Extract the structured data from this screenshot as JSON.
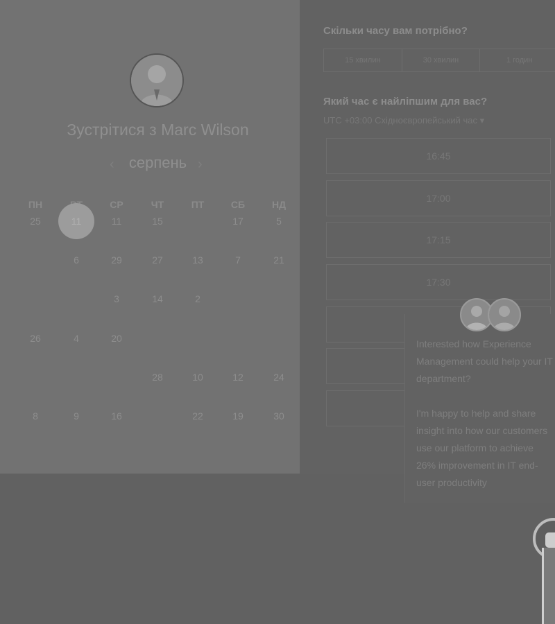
{
  "host": {
    "title": "Зустрітися з Marc Wilson",
    "avatar_icon": "person-avatar"
  },
  "calendar": {
    "month": "серпень",
    "prev_icon": "chevron-left-icon",
    "next_icon": "chevron-right-icon",
    "weekdays": [
      "ПН",
      "ВТ",
      "СР",
      "ЧТ",
      "ПТ",
      "СБ",
      "НД"
    ],
    "weeks": [
      [
        "25",
        "11",
        "11",
        "15",
        "",
        "17",
        "5"
      ],
      [
        "",
        "6",
        "29",
        "27",
        "13",
        "7",
        "21"
      ],
      [
        "",
        "",
        "3",
        "14",
        "2",
        "",
        ""
      ],
      [
        "26",
        "4",
        "20",
        "",
        "",
        "",
        ""
      ],
      [
        "",
        "",
        "",
        "28",
        "10",
        "12",
        "24"
      ],
      [
        "8",
        "9",
        "16",
        "",
        "22",
        "19",
        "30"
      ]
    ],
    "selected": "11"
  },
  "duration": {
    "question": "Скільки часу вам потрібно?",
    "options": [
      "15 хвилин",
      "30 хвилин",
      "1 годин"
    ]
  },
  "time": {
    "question": "Який час є найліпшим для вас?",
    "timezone": "UTC +03:00 Східноєвропейський час ▾",
    "slots": [
      "16:45",
      "17:00",
      "17:15",
      "17:30",
      "",
      "",
      ""
    ]
  },
  "chat": {
    "message": "Interested how Experience Management could help your IT department?\n\nI'm happy to help and share insight into how our customers use our platform to achieve 26% improvement in IT end-user productivity"
  }
}
